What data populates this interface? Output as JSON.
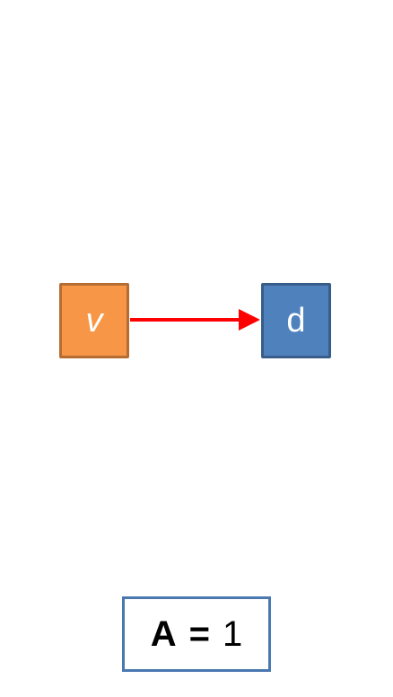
{
  "nodes": [
    {
      "id": "v",
      "label": "v",
      "fill": "#f79646",
      "border": "#b66d31"
    },
    {
      "id": "d",
      "label": "d",
      "fill": "#4f81bd",
      "border": "#385d8a"
    }
  ],
  "edges": [
    {
      "from": "v",
      "to": "d",
      "color": "#ff0000"
    }
  ],
  "equation": {
    "lhs": "A",
    "op": "=",
    "rhs": "1",
    "border_color": "#4a78b0"
  }
}
